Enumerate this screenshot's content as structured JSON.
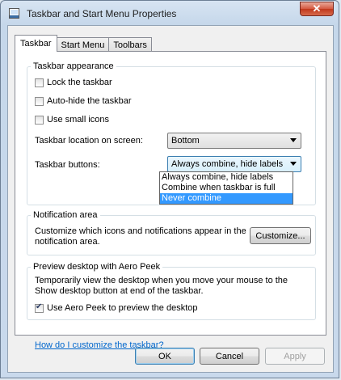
{
  "window": {
    "title": "Taskbar and Start Menu Properties",
    "close_symbol": "✕"
  },
  "tabs": [
    {
      "label": "Taskbar",
      "active": true
    },
    {
      "label": "Start Menu",
      "active": false
    },
    {
      "label": "Toolbars",
      "active": false
    }
  ],
  "appearance": {
    "legend": "Taskbar appearance",
    "lock_taskbar": {
      "label": "Lock the taskbar",
      "checked": false
    },
    "auto_hide": {
      "label": "Auto-hide the taskbar",
      "checked": false
    },
    "small_icons": {
      "label": "Use small icons",
      "checked": false
    },
    "location_label": "Taskbar location on screen:",
    "location_value": "Bottom",
    "buttons_label": "Taskbar buttons:",
    "buttons_value": "Always combine, hide labels",
    "buttons_options": [
      "Always combine, hide labels",
      "Combine when taskbar is full",
      "Never combine"
    ],
    "buttons_highlighted": "Never combine"
  },
  "notification": {
    "legend": "Notification area",
    "description_line1": "Customize which icons and notifications appear in the",
    "description_line2": "notification area.",
    "customize_button": "Customize..."
  },
  "aero_peek": {
    "legend": "Preview desktop with Aero Peek",
    "description_line1": "Temporarily view the desktop when you move your mouse to the",
    "description_line2": "Show desktop button at end of the taskbar.",
    "use_aero_peek": {
      "label": "Use Aero Peek to preview the desktop",
      "checked": true
    }
  },
  "help_link": "How do I customize the taskbar?",
  "buttons": {
    "ok": "OK",
    "cancel": "Cancel",
    "apply": "Apply"
  }
}
